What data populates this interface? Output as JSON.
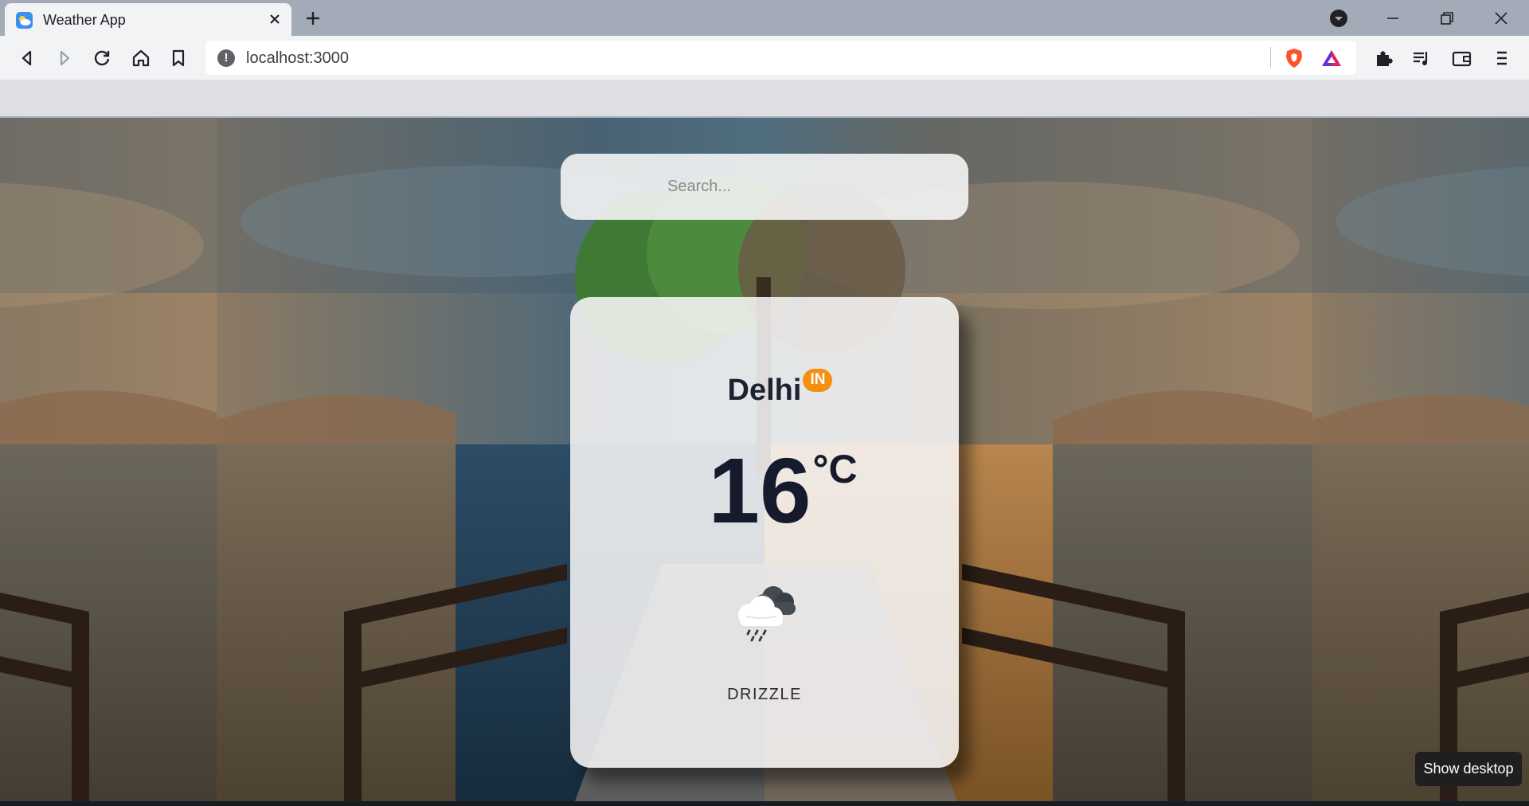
{
  "browser": {
    "tab_title": "Weather App",
    "url": "localhost:3000"
  },
  "search": {
    "placeholder": "Search..."
  },
  "weather": {
    "city": "Delhi",
    "country_code": "IN",
    "temperature": "16",
    "unit": "°C",
    "condition": "DRIZZLE",
    "icon": "drizzle-cloud-icon"
  },
  "taskbar": {
    "show_desktop_label": "Show desktop"
  },
  "colors": {
    "country_badge": "#f39012",
    "card_bg": "#f8f7f7",
    "text_dark": "#1c2232"
  }
}
